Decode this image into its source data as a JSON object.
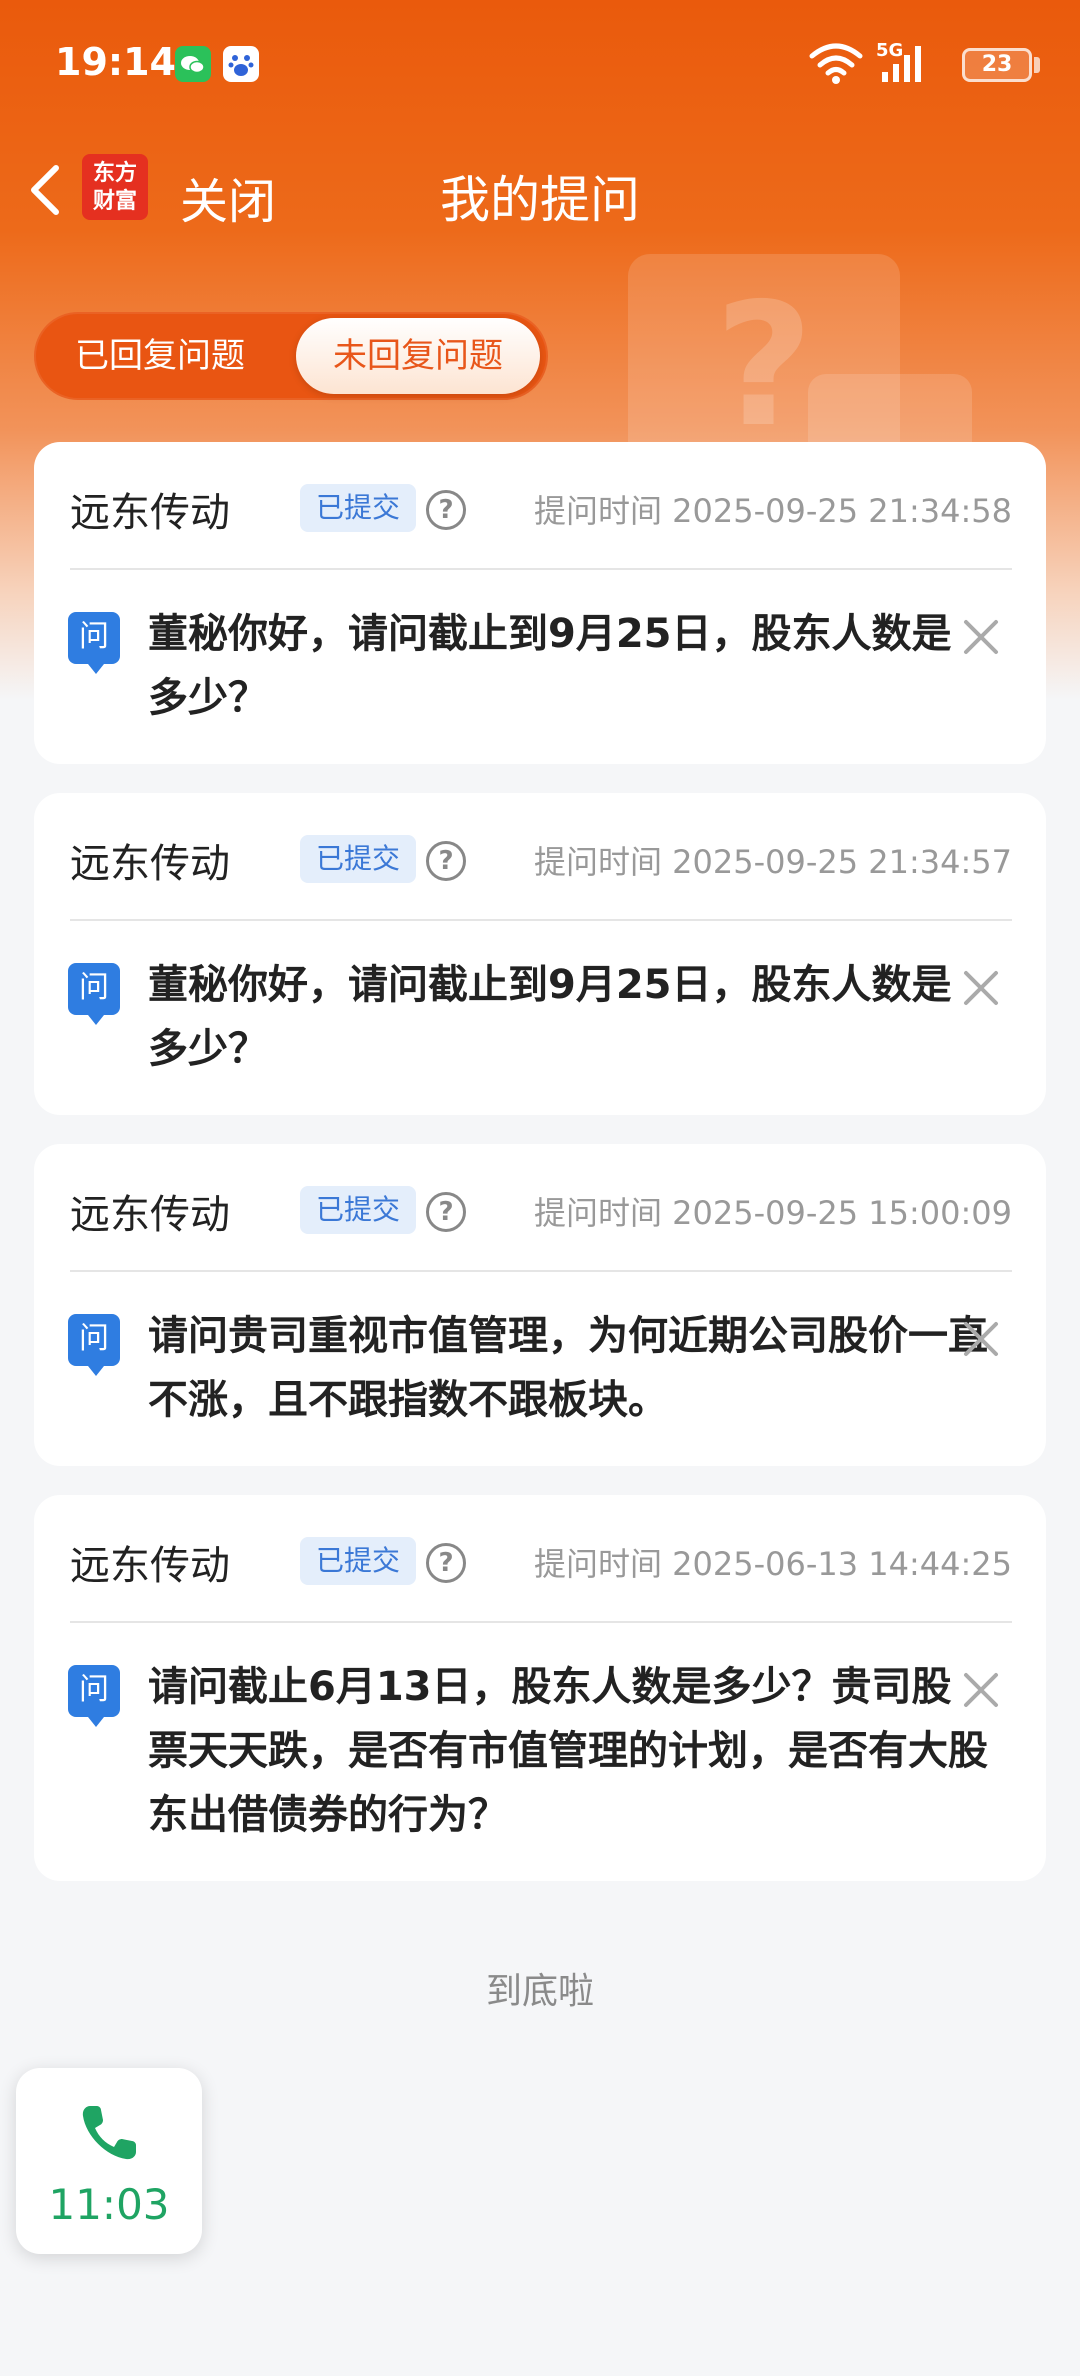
{
  "status_bar": {
    "time": "19:14",
    "network": "5G",
    "battery": "23"
  },
  "nav": {
    "logo_line1": "东方",
    "logo_line2": "财富",
    "close_label": "关闭",
    "title": "我的提问"
  },
  "tabs": [
    {
      "label": "已回复问题",
      "active": false
    },
    {
      "label": "未回复问题",
      "active": true
    }
  ],
  "questions": [
    {
      "company": "远东传动",
      "status": "已提交",
      "time": "提问时间 2025-09-25 21:34:58",
      "icon_label": "问",
      "text": "董秘你好，请问截止到9月25日，股东人数是多少？"
    },
    {
      "company": "远东传动",
      "status": "已提交",
      "time": "提问时间 2025-09-25 21:34:57",
      "icon_label": "问",
      "text": "董秘你好，请问截止到9月25日，股东人数是多少？"
    },
    {
      "company": "远东传动",
      "status": "已提交",
      "time": "提问时间 2025-09-25 15:00:09",
      "icon_label": "问",
      "text": "请问贵司重视市值管理，为何近期公司股价一直不涨，且不跟指数不跟板块。"
    },
    {
      "company": "远东传动",
      "status": "已提交",
      "time": "提问时间 2025-06-13 14:44:25",
      "icon_label": "问",
      "text": "请问截止6月13日，股东人数是多少？贵司股票天天跌，是否有市值管理的计划，是否有大股东出借债券的行为？"
    }
  ],
  "bottom_tip": "到底啦",
  "call_widget": {
    "duration": "11:03"
  },
  "colors": {
    "brand": "#ea5a0c",
    "badge_blue": "#3b78d6",
    "call_green": "#1fa463"
  }
}
